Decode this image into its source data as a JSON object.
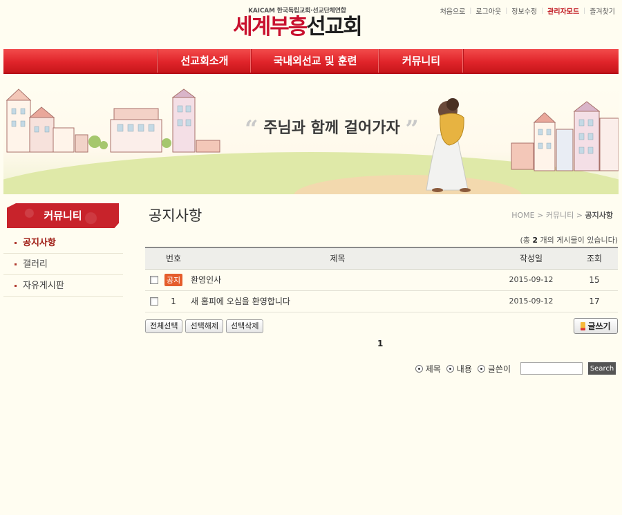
{
  "toplinks": [
    "처음으로",
    "로그아웃",
    "정보수정",
    "관리자모드",
    "즐겨찾기"
  ],
  "logo": {
    "sub": "KAICAM 한국독립교회·선교단체연합",
    "main_red": "세계부흥",
    "main_black": "선교회"
  },
  "nav": [
    "선교회소개",
    "국내외선교 및 훈련",
    "커뮤니티"
  ],
  "banner": {
    "slogan": "주님과 함께 걸어가자",
    "quote_open": "“",
    "quote_close": "”"
  },
  "sidebar": {
    "title": "커뮤니티",
    "items": [
      {
        "label": "공지사항",
        "active": true
      },
      {
        "label": "갤러리",
        "active": false
      },
      {
        "label": "자유게시판",
        "active": false
      }
    ]
  },
  "page": {
    "title": "공지사항",
    "breadcrumb": [
      "HOME",
      "커뮤니티",
      "공지사항"
    ],
    "breadcrumb_sep": ">",
    "total_prefix": "(총",
    "total_count": "2",
    "total_suffix": "개의 게시물이 있습니다)"
  },
  "table": {
    "headers": {
      "num": "번호",
      "subject": "제목",
      "author": "작성일",
      "views": "조회"
    },
    "rows": [
      {
        "num": "공지",
        "notice": true,
        "subject": "환영인사",
        "date": "2015-09-12",
        "views": "15"
      },
      {
        "num": "1",
        "notice": false,
        "subject": "새 홈피에 오심을 환영합니다",
        "date": "2015-09-12",
        "views": "17"
      }
    ]
  },
  "buttons": {
    "select_all": "전체선택",
    "deselect": "선택해제",
    "delete": "선택삭제",
    "write": "글쓰기"
  },
  "pager": {
    "current": "1"
  },
  "search": {
    "options": [
      {
        "label": "제목",
        "checked": true
      },
      {
        "label": "내용",
        "checked": true
      },
      {
        "label": "글쓴이",
        "checked": true
      }
    ],
    "button": "Search"
  }
}
